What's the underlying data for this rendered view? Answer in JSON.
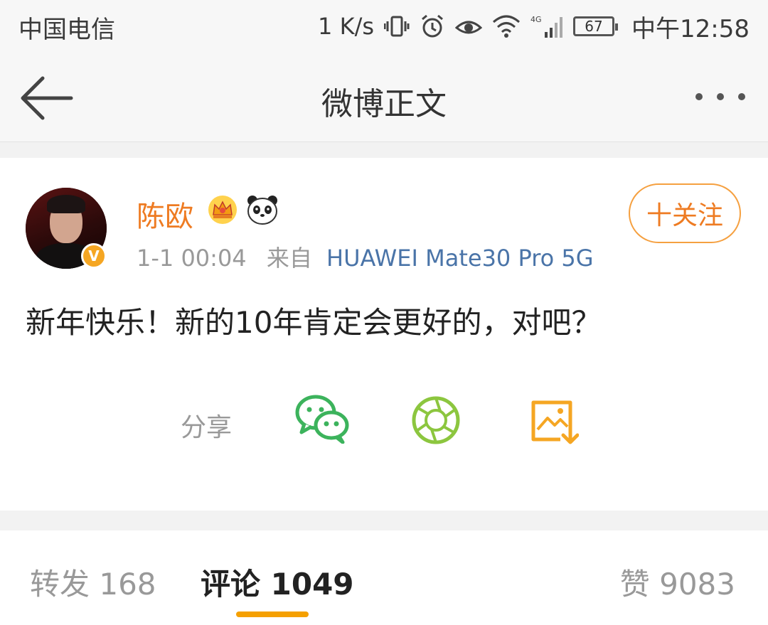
{
  "status_bar": {
    "carrier": "中国电信",
    "net_speed": "1 K/s",
    "network_type": "4G",
    "battery_level": "67",
    "time": "中午12:58",
    "icons": [
      "vibrate-icon",
      "alarm-icon",
      "eye-icon",
      "wifi-icon",
      "signal-icon",
      "battery-icon"
    ]
  },
  "nav": {
    "title": "微博正文",
    "back_icon": "arrow-left-icon",
    "more_icon": "more-dots-icon"
  },
  "post": {
    "author": "陈欧",
    "verified_badge": "V",
    "time": "1-1 00:04",
    "from_label": "来自",
    "device": "HUAWEI Mate30 Pro 5G",
    "follow_label": "十关注",
    "text": "新年快乐！新的10年肯定会更好的，对吧？",
    "share_label": "分享",
    "share_targets": [
      "wechat-icon",
      "moments-icon",
      "save-image-icon"
    ]
  },
  "tabs": {
    "repost": "转发 168",
    "comments": "评论 1049",
    "likes": "赞 9083",
    "active": "comments"
  },
  "colors": {
    "accent_orange": "#ee7b22",
    "link_blue": "#4a74a8",
    "wechat_green": "#3cb35c",
    "moments_green": "#8cc63f",
    "save_orange": "#f5a623",
    "tab_underline": "#f5a000"
  }
}
